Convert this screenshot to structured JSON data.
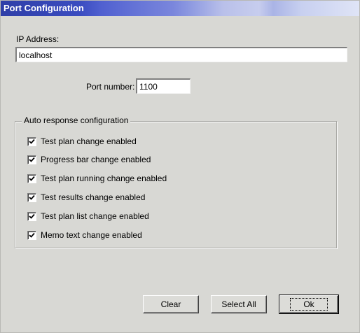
{
  "window": {
    "title": "Port Configuration"
  },
  "ip": {
    "label": "IP Address:",
    "value": "localhost"
  },
  "port": {
    "label": "Port number:",
    "value": "1100"
  },
  "auto": {
    "title": "Auto response configuration",
    "items": [
      {
        "label": "Test plan change enabled",
        "checked": true
      },
      {
        "label": "Progress bar change enabled",
        "checked": true
      },
      {
        "label": "Test plan running change enabled",
        "checked": true
      },
      {
        "label": "Test results change enabled",
        "checked": true
      },
      {
        "label": "Test plan list change enabled",
        "checked": true
      },
      {
        "label": "Memo text change enabled",
        "checked": true
      }
    ]
  },
  "buttons": {
    "clear": "Clear",
    "select_all": "Select All",
    "ok": "Ok"
  }
}
